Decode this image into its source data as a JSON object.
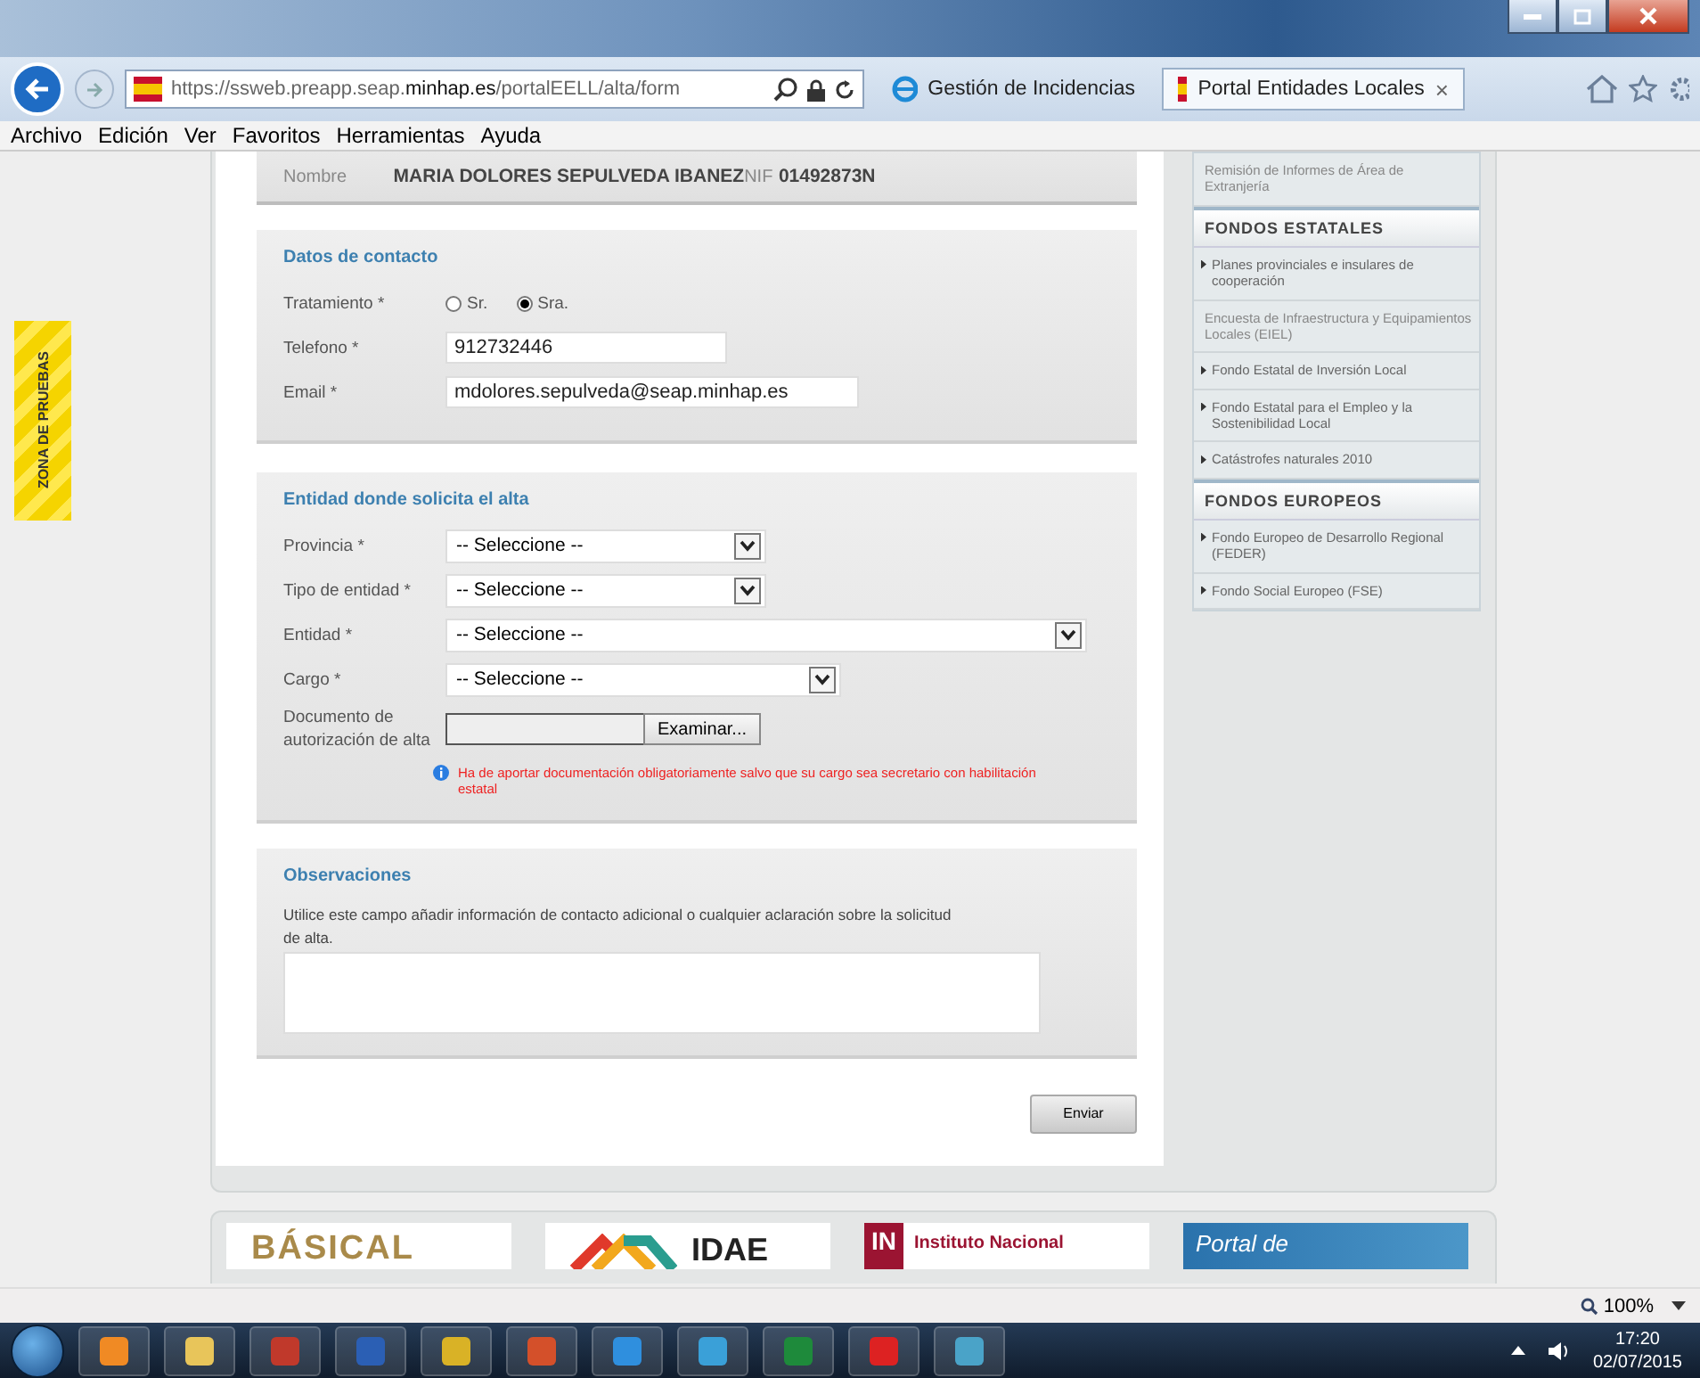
{
  "browser": {
    "url": "https://ssweb.preapp.seap.**minhap.es**/portalEELL/alta/form",
    "tabs": [
      {
        "label": "Gestión de Incidencias",
        "selected": false
      },
      {
        "label": "Portal Entidades Locales",
        "selected": true,
        "close": "×"
      }
    ],
    "menu": [
      "Archivo",
      "Edición",
      "Ver",
      "Favoritos",
      "Herramientas",
      "Ayuda"
    ]
  },
  "sandbox_badge": "ZONA DE PRUEBAS",
  "identity": {
    "name_label": "Nombre",
    "name": "MARIA DOLORES SEPULVEDA IBANEZ",
    "nif_label": "NIF",
    "nif": "01492873N"
  },
  "contact": {
    "title": "Datos de contacto",
    "fields": [
      {
        "kind": "radio",
        "label": "Tratamiento *",
        "options": [
          {
            "label": "Sr.",
            "selected": false
          },
          {
            "label": "Sra.",
            "selected": true
          }
        ]
      },
      {
        "kind": "text",
        "label": "Telefono *",
        "value": "912732446"
      },
      {
        "kind": "text",
        "label": "Email *",
        "value": "mdolores.sepulveda@seap.minhap.es"
      }
    ]
  },
  "entity": {
    "title": "Entidad donde solicita el alta",
    "fields": [
      {
        "kind": "select",
        "label": "Provincia *",
        "value": "-- Seleccione --"
      },
      {
        "kind": "select",
        "label": "Tipo de entidad *",
        "value": "-- Seleccione --"
      },
      {
        "kind": "select",
        "label": "Entidad *",
        "value": "-- Seleccione --"
      },
      {
        "kind": "select",
        "label": "Cargo *",
        "value": "-- Seleccione --"
      },
      {
        "kind": "file",
        "label": "Documento de autorización de alta",
        "button": "Examinar..."
      }
    ],
    "note": "Ha de aportar documentación obligatoriamente salvo que su cargo sea secretario con habilitación estatal"
  },
  "observations": {
    "title": "Observaciones",
    "hint": "Utilice este campo añadir información de contacto adicional o cualquier aclaración sobre la solicitud de alta."
  },
  "submit": "Enviar",
  "sidebar": [
    {
      "items": [
        {
          "label": "Remisión de Informes de Área de Extranjería",
          "bullet": false
        }
      ]
    },
    {
      "header": "FONDOS ESTATALES",
      "items": [
        {
          "label": "Planes provinciales e insulares de cooperación",
          "bullet": true
        },
        {
          "label": "Encuesta de Infraestructura y Equipamientos Locales (EIEL)",
          "bullet": false
        },
        {
          "label": "Fondo Estatal de Inversión Local",
          "bullet": true
        },
        {
          "label": "Fondo Estatal para el Empleo y la Sostenibilidad Local",
          "bullet": true
        },
        {
          "label": "Catástrofes naturales 2010",
          "bullet": true
        }
      ]
    },
    {
      "header": "FONDOS EUROPEOS",
      "items": [
        {
          "label": "Fondo Europeo de Desarrollo Regional (FEDER)",
          "bullet": true
        },
        {
          "label": "Fondo Social Europeo (FSE)",
          "bullet": true
        }
      ]
    }
  ],
  "footer_logos": [
    {
      "kind": "basical",
      "text": "BÁSICAL"
    },
    {
      "kind": "idae",
      "text": "IDAE"
    },
    {
      "kind": "ine",
      "mark": "IN",
      "text": "Instituto Nacional"
    },
    {
      "kind": "portal",
      "text": "Portal de"
    }
  ],
  "status_bar": {
    "zoom": "100%"
  },
  "taskbar": {
    "time": "17:20",
    "date": "02/07/2015"
  }
}
